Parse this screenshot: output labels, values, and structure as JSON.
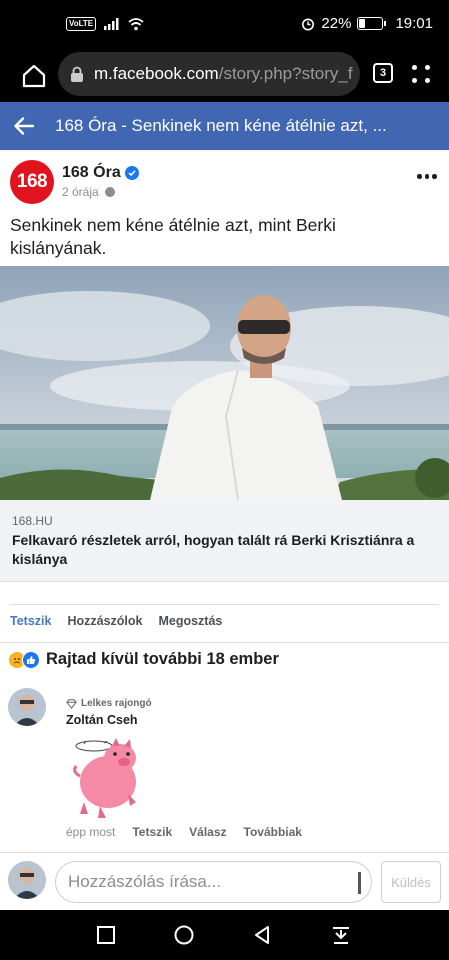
{
  "status_bar": {
    "volte": "VoLTE",
    "battery": "22%",
    "time": "19:01",
    "battery_level": 0.22
  },
  "browser": {
    "url_host": "m.facebook.com",
    "url_path": "/story.php?story_f",
    "tab_count": "3"
  },
  "header": {
    "title": "168 Óra - Senkinek nem kéne átélnie azt, ..."
  },
  "post": {
    "page_logo": "168",
    "page_name": "168 Óra",
    "time": "2 órája",
    "text": "Senkinek nem kéne átélnie azt, mint Berki kislányának.",
    "link": {
      "domain": "168.HU",
      "title": "Felkavaró részletek arról, hogyan talált rá Berki Krisztiánra a kislánya"
    },
    "actions": [
      "Tetszik",
      "Hozzászólok",
      "Megosztás"
    ],
    "reactions_text": "Rajtad kívül további 18 ember"
  },
  "comment": {
    "badge": "Lelkes rajongó",
    "author": "Zoltán Cseh",
    "time": "épp most",
    "actions": [
      "Tetszik",
      "Válasz",
      "Továbbiak"
    ]
  },
  "compose": {
    "placeholder": "Hozzászólás írása...",
    "send_label": "Küldés"
  },
  "colors": {
    "fb_blue": "#4267b2",
    "link_active": "#4a76c8",
    "brand_red": "#e0141e"
  },
  "icons": [
    "home-icon",
    "lock-icon",
    "tabs-icon",
    "menu-icon",
    "back-arrow-icon",
    "verified-icon",
    "globe-icon",
    "more-icon",
    "sad-reaction-icon",
    "like-reaction-icon",
    "diamond-icon",
    "square-nav-icon",
    "circle-nav-icon",
    "triangle-nav-icon",
    "download-nav-icon"
  ]
}
